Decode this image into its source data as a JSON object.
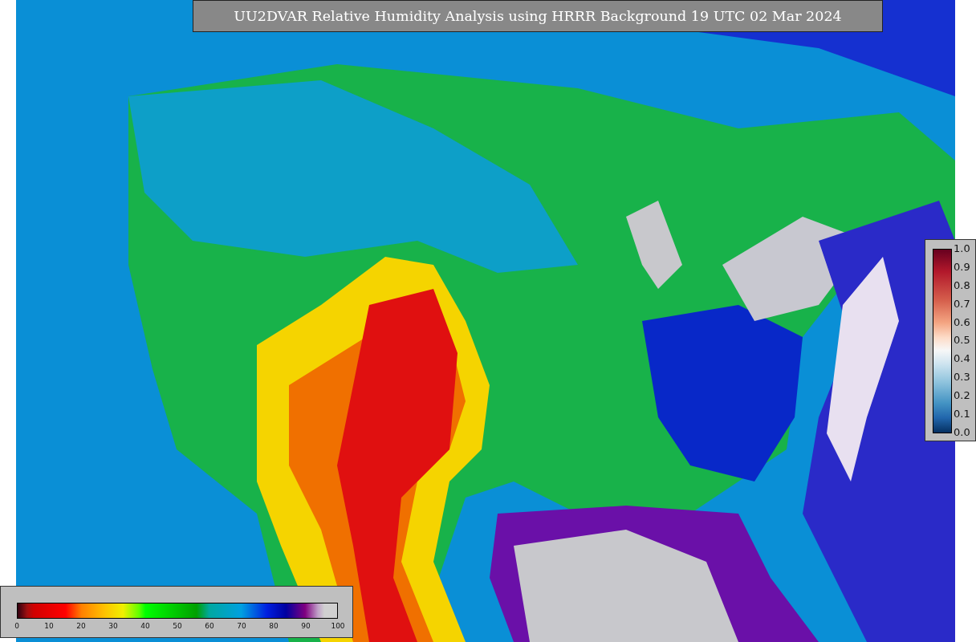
{
  "title": "UU2DVAR Relative Humidity Analysis using HRRR Background 19 UTC 02 Mar 2024",
  "side_colorbar": {
    "labels": [
      "1.0",
      "0.9",
      "0.8",
      "0.7",
      "0.6",
      "0.5",
      "0.4",
      "0.3",
      "0.2",
      "0.1",
      "0.0"
    ]
  },
  "bottom_colorbar": {
    "labels": [
      "0",
      "10",
      "20",
      "30",
      "40",
      "50",
      "60",
      "70",
      "80",
      "90",
      "100"
    ]
  }
}
